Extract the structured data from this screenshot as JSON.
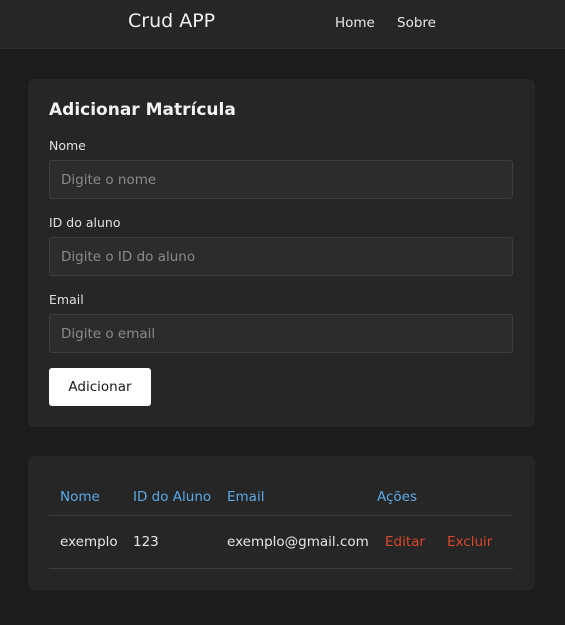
{
  "navbar": {
    "brand": "Crud APP",
    "links": [
      {
        "label": "Home"
      },
      {
        "label": "Sobre"
      }
    ]
  },
  "form": {
    "title": "Adicionar Matrícula",
    "fields": [
      {
        "label": "Nome",
        "value": "",
        "placeholder": "Digite o nome"
      },
      {
        "label": "ID do aluno",
        "value": "",
        "placeholder": "Digite o ID do aluno"
      },
      {
        "label": "Email",
        "value": "",
        "placeholder": "Digite o email"
      }
    ],
    "submit_label": "Adicionar"
  },
  "table": {
    "headers": [
      "Nome",
      "ID do Aluno",
      "Email",
      "Ações"
    ],
    "rows": [
      {
        "nome": "exemplo",
        "id": "123",
        "email": "exemplo@gmail.com",
        "edit_label": "Editar",
        "delete_label": "Excluir"
      }
    ]
  },
  "colors": {
    "background": "#1c1c1c",
    "card": "#262626",
    "header_text": "#5aa9e6",
    "action_link": "#d9472b",
    "button_bg": "#ffffff"
  }
}
